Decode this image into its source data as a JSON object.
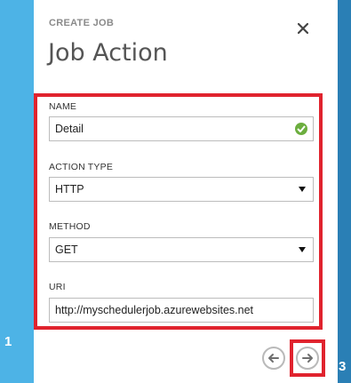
{
  "wizard": {
    "eyebrow": "CREATE JOB",
    "title": "Job Action",
    "close_icon": "close-icon",
    "steps": {
      "left": "1",
      "right": "3"
    }
  },
  "form": {
    "name_label": "NAME",
    "name_value": "Detail",
    "action_type_label": "ACTION TYPE",
    "action_type_value": "HTTP",
    "method_label": "METHOD",
    "method_value": "GET",
    "uri_label": "URI",
    "uri_value": "http://myschedulerjob.azurewebsites.net"
  },
  "nav": {
    "back_icon": "arrow-left-icon",
    "next_icon": "arrow-right-icon"
  },
  "colors": {
    "accent_left": "#4db3e6",
    "accent_right": "#2a7fb5",
    "highlight": "#e0232e",
    "valid": "#6cae3f"
  }
}
